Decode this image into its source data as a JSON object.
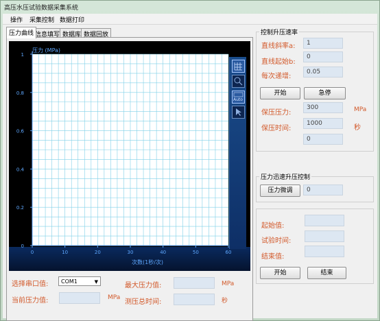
{
  "window": {
    "title": "高压水压试验数据采集系统"
  },
  "menu": {
    "items": [
      "操作",
      "采集控制",
      "数据打印"
    ]
  },
  "tabs": [
    "压力曲线",
    "信息填写",
    "数据库",
    "数据回放"
  ],
  "chart_data": {
    "type": "line",
    "ylabel": "压力 (MPa)",
    "xlabel": "次数(1秒/次)",
    "xlim": [
      0,
      60
    ],
    "ylim": [
      0,
      1
    ],
    "x_ticks": [
      0,
      10,
      20,
      30,
      40,
      50,
      60
    ],
    "y_ticks": [
      0,
      0.2,
      0.4,
      0.6,
      0.8,
      1
    ],
    "grid": true,
    "series": []
  },
  "chart_tools": [
    {
      "icon": "grid-icon",
      "label": "",
      "active": true
    },
    {
      "icon": "zoom-icon",
      "label": "",
      "active": false
    },
    {
      "icon": "auto-scale-icon",
      "label": "Auto",
      "active": true
    },
    {
      "icon": "cursor-icon",
      "label": "",
      "active": false
    }
  ],
  "bottom": {
    "port_label": "选择串口值:",
    "port_value": "COM1",
    "current_pressure_label": "当前压力值:",
    "current_pressure_value": "",
    "current_pressure_unit": "MPa",
    "max_pressure_label": "最大压力值:",
    "max_pressure_value": "",
    "max_pressure_unit": "MPa",
    "total_time_label": "测压总时间:",
    "total_time_value": "",
    "total_time_unit": "秒"
  },
  "rate_control": {
    "title": "控制升压速率",
    "slope_label": "直线斜率a:",
    "slope_value": "1",
    "intercept_label": "直线起始b:",
    "intercept_value": "0",
    "step_label": "每次递增:",
    "step_value": "0.05",
    "start_button": "开始",
    "stop_button": "急停",
    "hold_pressure_label": "保压压力:",
    "hold_pressure_value": "300",
    "hold_pressure_unit": "MPa",
    "hold_time_label": "保压时间:",
    "hold_time_value": "1000",
    "hold_time_unit": "秒",
    "extra_value": "0"
  },
  "fast_control": {
    "title": "压力迅速升压控制",
    "fine_tune_button": "压力微调",
    "fine_tune_value": "0"
  },
  "test_panel": {
    "start_value_label": "起始值:",
    "test_time_label": "试验时间:",
    "end_value_label": "结束值:",
    "start_value": "",
    "test_time_value": "",
    "end_value": "",
    "start_button": "开始",
    "end_button": "结束"
  }
}
